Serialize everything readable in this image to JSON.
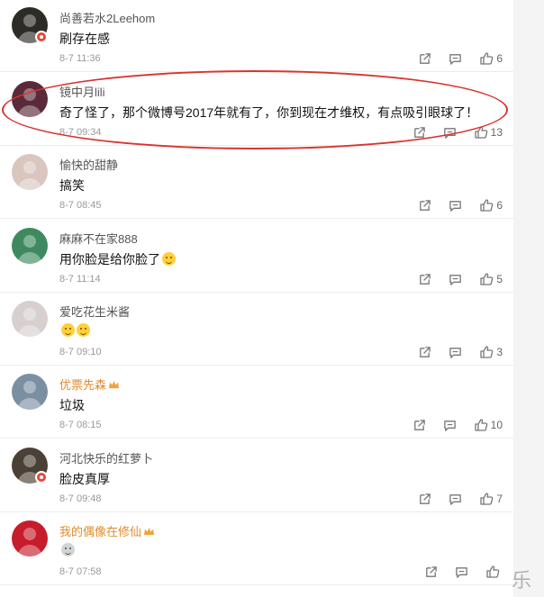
{
  "comments": [
    {
      "username": "尚善若水2Leehom",
      "text": "刷存在感",
      "time": "8-7 11:36",
      "likes": "6",
      "vip": false,
      "verified": true,
      "emoji": 0,
      "avatar_color": "#2d2b27"
    },
    {
      "username": "镜中月lili",
      "text": "奇了怪了，那个微博号2017年就有了，你到现在才维权，有点吸引眼球了！",
      "time": "8-7 09:34",
      "likes": "13",
      "vip": false,
      "verified": false,
      "emoji": 0,
      "avatar_color": "#5a2a3a"
    },
    {
      "username": "愉快的甜静",
      "text": "搞笑",
      "time": "8-7 08:45",
      "likes": "6",
      "vip": false,
      "verified": false,
      "emoji": 0,
      "avatar_color": "#d9c6bf"
    },
    {
      "username": "麻麻不在家888",
      "text": "用你脸是给你脸了",
      "time": "8-7 11:14",
      "likes": "5",
      "vip": false,
      "verified": false,
      "emoji": 1,
      "avatar_color": "#3e8a5e"
    },
    {
      "username": "爱吃花生米酱",
      "text": "",
      "time": "8-7 09:10",
      "likes": "3",
      "vip": false,
      "verified": false,
      "emoji": 2,
      "avatar_color": "#d8cfcf"
    },
    {
      "username": "优票先森",
      "text": "垃圾",
      "time": "8-7 08:15",
      "likes": "10",
      "vip": true,
      "verified": false,
      "emoji": 0,
      "avatar_color": "#7b8fa3"
    },
    {
      "username": "河北快乐的红萝卜",
      "text": "脸皮真厚",
      "time": "8-7 09:48",
      "likes": "7",
      "vip": false,
      "verified": true,
      "emoji": 0,
      "avatar_color": "#4a4035"
    },
    {
      "username": "我的偶像在修仙",
      "text": "",
      "time": "8-7 07:58",
      "likes": "",
      "vip": true,
      "verified": false,
      "emoji": 3,
      "avatar_color": "#c61d2c"
    }
  ],
  "icons": {
    "share": "share-icon",
    "reply": "comment-icon",
    "like": "thumbs-up-icon"
  },
  "colors": {
    "highlight": "#d7352f",
    "vip_name": "#e08b2c",
    "verified_badge": "#e6483a"
  },
  "watermark": "乐"
}
